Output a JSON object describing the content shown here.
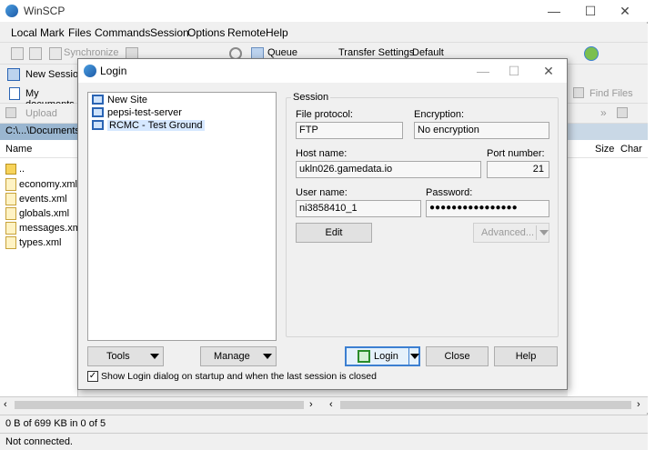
{
  "app": {
    "title": "WinSCP",
    "menu": [
      "Local",
      "Mark",
      "Files",
      "Commands",
      "Session",
      "Options",
      "Remote",
      "Help"
    ],
    "toolbar": {
      "synchronize": "Synchronize",
      "queue": "Queue",
      "transfer_settings_label": "Transfer Settings",
      "transfer_settings_value": "Default"
    },
    "new_session_tab": "New Session",
    "left_panel": {
      "location": "My documents",
      "upload": "Upload",
      "path": "C:\\...\\Documents",
      "column_name": "Name",
      "files": [
        "..",
        "economy.xml",
        "events.xml",
        "globals.xml",
        "messages.xml",
        "types.xml"
      ]
    },
    "right_panel": {
      "find_files": "Find Files",
      "column_size": "Size",
      "column_changed": "Char"
    },
    "status": {
      "transfer": "0 B of 699 KB in 0 of 5",
      "connection": "Not connected."
    }
  },
  "login": {
    "title": "Login",
    "sites": [
      {
        "name": "New Site"
      },
      {
        "name": "pepsi-test-server"
      },
      {
        "name": "RCMC - Test Ground",
        "selected": true
      }
    ],
    "session_label": "Session",
    "file_protocol_label": "File protocol:",
    "file_protocol_value": "FTP",
    "encryption_label": "Encryption:",
    "encryption_value": "No encryption",
    "host_label": "Host name:",
    "host_value": "ukln026.gamedata.io",
    "port_label": "Port number:",
    "port_value": "21",
    "user_label": "User name:",
    "user_value": "ni3858410_1",
    "password_label": "Password:",
    "password_value": "●●●●●●●●●●●●●●●●",
    "edit_button": "Edit",
    "advanced_button": "Advanced...",
    "tools_button": "Tools",
    "manage_button": "Manage",
    "login_button": "Login",
    "close_button": "Close",
    "help_button": "Help",
    "show_login_checkbox": "Show Login dialog on startup and when the last session is closed",
    "show_login_checked": true
  }
}
